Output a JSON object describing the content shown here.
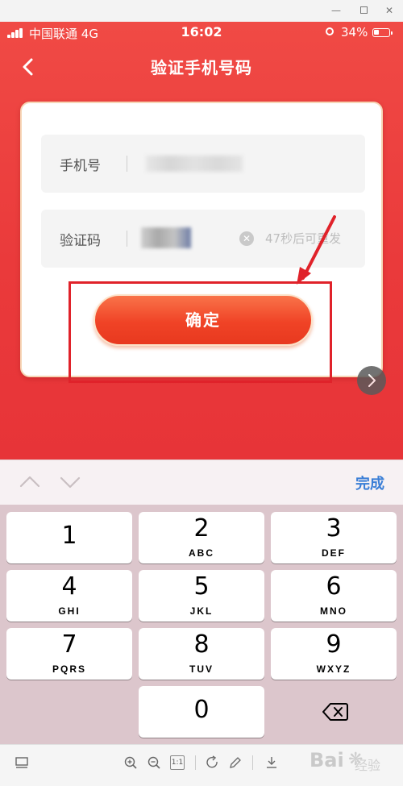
{
  "status_bar": {
    "carrier": "中国联通",
    "network": "4G",
    "time": "16:02",
    "battery": "34%"
  },
  "nav": {
    "title": "验证手机号码"
  },
  "form": {
    "phone_label": "手机号",
    "code_label": "验证码",
    "clear_glyph": "✕",
    "resend_text": "47秒后可重发",
    "confirm_label": "确定"
  },
  "keyboard_toolbar": {
    "done_label": "完成"
  },
  "keys": [
    {
      "num": "1",
      "letters": ""
    },
    {
      "num": "2",
      "letters": "ABC"
    },
    {
      "num": "3",
      "letters": "DEF"
    },
    {
      "num": "4",
      "letters": "GHI"
    },
    {
      "num": "5",
      "letters": "JKL"
    },
    {
      "num": "6",
      "letters": "MNO"
    },
    {
      "num": "7",
      "letters": "PQRS"
    },
    {
      "num": "8",
      "letters": "TUV"
    },
    {
      "num": "9",
      "letters": "WXYZ"
    },
    {
      "num": "0",
      "letters": ""
    }
  ],
  "viewer_toolbar": {
    "actual_size_label": "1:1"
  },
  "watermark": {
    "text": "Bai",
    "suffix": "经验"
  },
  "colors": {
    "hero_red": "#ea3a3b",
    "confirm_orange": "#f04326",
    "highlight_red": "#e0222a",
    "done_blue": "#3a7ed6",
    "keyboard_bg": "#dcc6cc"
  },
  "icons": {
    "back": "chevron-left-icon",
    "clear": "clear-circle-icon",
    "next": "chevron-right-icon",
    "delete": "backspace-icon"
  }
}
